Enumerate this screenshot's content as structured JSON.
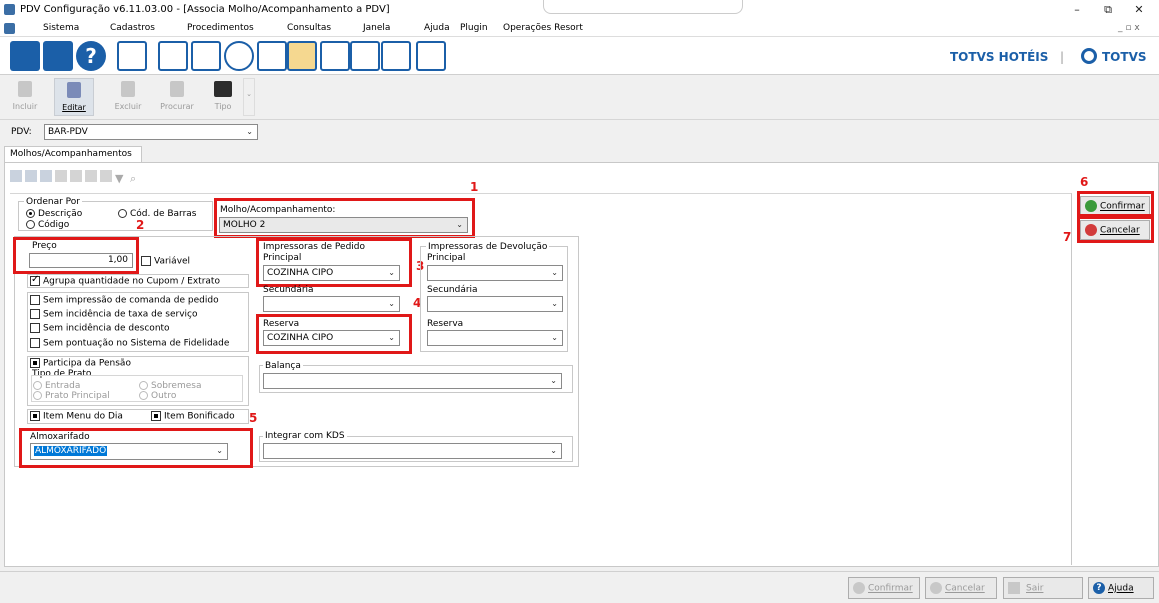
{
  "window": {
    "title": "PDV Configuração v6.11.03.00 - [Associa Molho/Acompanhamento a PDV]",
    "minimize": "–",
    "restore": "⧉",
    "close": "✕",
    "mdi_min": "_",
    "mdi_restore": "▫",
    "mdi_close": "x"
  },
  "menu": [
    "Sistema",
    "Cadastros",
    "Procedimentos",
    "Consultas",
    "Janela",
    "Ajuda",
    "Plugin",
    "Operações Resort"
  ],
  "brand": {
    "left": "TOTVS HOTÉIS",
    "sep": "|",
    "right": "TOTVS"
  },
  "actions": [
    "Incluir",
    "Editar",
    "Excluir",
    "Procurar",
    "Tipo"
  ],
  "pdv": {
    "label": "PDV:",
    "value": "BAR-PDV"
  },
  "tab": "Molhos/Acompanhamentos",
  "ordenar": {
    "title": "Ordenar Por",
    "options": [
      "Descrição",
      "Cód. de Barras",
      "Código"
    ]
  },
  "molho": {
    "label": "Molho/Acompanhamento:",
    "value": "MOLHO 2"
  },
  "preco": {
    "label": "Preço",
    "value": "1,00",
    "variavel": "Variável"
  },
  "checks": {
    "agrupa": "Agrupa quantidade no Cupom / Extrato",
    "sem_impressao": "Sem impressão de comanda de pedido",
    "sem_taxa": "Sem incidência de taxa de serviço",
    "sem_desconto": "Sem incidência de desconto",
    "sem_pontuacao": "Sem pontuação no Sistema de Fidelidade",
    "participa": "Participa da Pensão",
    "item_menu": "Item Menu do Dia",
    "item_bonificado": "Item Bonificado"
  },
  "tipo_prato": {
    "title": "Tipo de Prato",
    "options": [
      "Entrada",
      "Sobremesa",
      "Prato Principal",
      "Outro"
    ]
  },
  "almox": {
    "label": "Almoxarifado",
    "value": "ALMOXARIFADO"
  },
  "imp_pedido": {
    "title": "Impressoras de Pedido",
    "principal_label": "Principal",
    "principal": "COZINHA CIPO",
    "secundaria_label": "Secundária",
    "secundaria": "",
    "reserva_label": "Reserva",
    "reserva": "COZINHA CIPO"
  },
  "imp_devolucao": {
    "title": "Impressoras de Devolução",
    "principal_label": "Principal",
    "secundaria_label": "Secundária",
    "reserva_label": "Reserva"
  },
  "balanca": {
    "label": "Balança",
    "value": ""
  },
  "kds": {
    "label": "Integrar com KDS",
    "value": ""
  },
  "side_buttons": {
    "confirmar": "Confirmar",
    "cancelar": "Cancelar"
  },
  "bottom_buttons": {
    "confirmar": "Confirmar",
    "cancelar": "Cancelar",
    "sair": "Sair",
    "ajuda": "Ajuda"
  },
  "annotations": [
    "1",
    "2",
    "3",
    "4",
    "5",
    "6",
    "7"
  ],
  "colors": {
    "accent": "#1b5fa8",
    "highlight": "#e01818",
    "selection": "#0078d7"
  }
}
